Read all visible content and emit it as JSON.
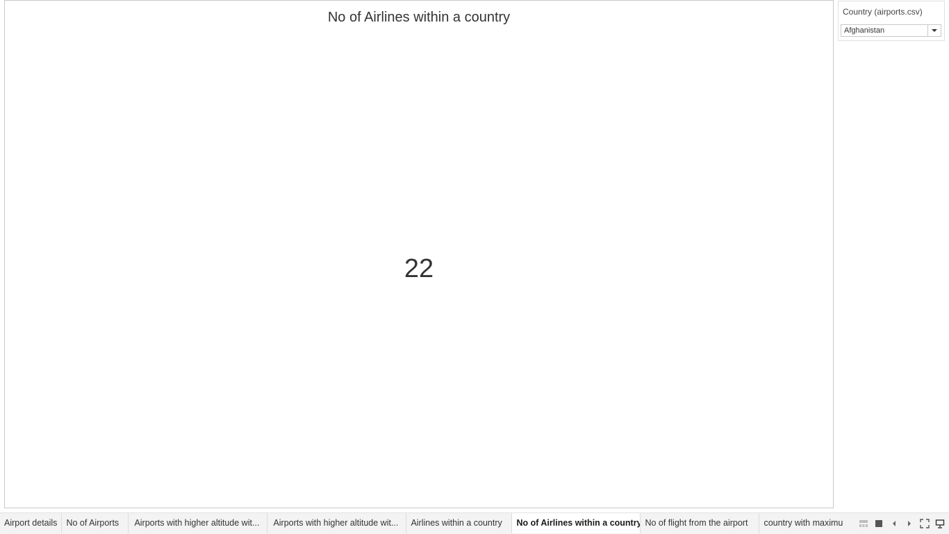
{
  "sheet": {
    "title": "No of Airlines within a country",
    "value": "22"
  },
  "filter": {
    "title": "Country (airports.csv)",
    "selected": "Afghanistan"
  },
  "tabs": [
    {
      "label": "Airport details"
    },
    {
      "label": "No of Airports"
    },
    {
      "label": "Airports with higher altitude wit..."
    },
    {
      "label": "Airports with higher altitude wit..."
    },
    {
      "label": "Airlines within a country"
    },
    {
      "label": "No of Airlines within a country",
      "active": true
    },
    {
      "label": "No of flight from the airport"
    },
    {
      "label": "country with maximu"
    }
  ],
  "controls": {
    "icons": [
      "filmstrip-view-icon",
      "sheet-view-icon",
      "previous-tab-icon",
      "next-tab-icon",
      "fullscreen-icon",
      "presentation-mode-icon"
    ]
  }
}
